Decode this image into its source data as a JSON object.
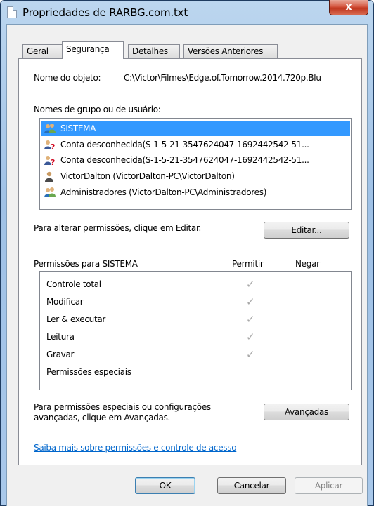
{
  "window": {
    "title": "Propriedades de RARBG.com.txt",
    "close_label": "x"
  },
  "tabs": [
    {
      "label": "Geral"
    },
    {
      "label": "Segurança"
    },
    {
      "label": "Detalhes"
    },
    {
      "label": "Versões Anteriores"
    }
  ],
  "security": {
    "object_name_label": "Nome do objeto:",
    "object_name_value": "C:\\Victor\\Filmes\\Edge.of.Tomorrow.2014.720p.Blu",
    "groups_label": "Nomes de grupo ou de usuário:",
    "groups": [
      {
        "label": "SISTEMA",
        "icon": "group-users-icon",
        "selected": true
      },
      {
        "label": "Conta desconhecida(S-1-5-21-3547624047-1692442542-51...",
        "icon": "unknown-user-icon",
        "selected": false
      },
      {
        "label": "Conta desconhecida(S-1-5-21-3547624047-1692442542-51...",
        "icon": "unknown-user-icon",
        "selected": false
      },
      {
        "label": "VictorDalton (VictorDalton-PC\\VictorDalton)",
        "icon": "user-icon",
        "selected": false
      },
      {
        "label": "Administradores (VictorDalton-PC\\Administradores)",
        "icon": "group-users-icon",
        "selected": false
      }
    ],
    "change_permissions_text": "Para alterar permissões, clique em Editar.",
    "edit_button": "Editar...",
    "permissions_for_label": "Permissões para SISTEMA",
    "allow_header": "Permitir",
    "deny_header": "Negar",
    "permissions": [
      {
        "label": "Controle total",
        "allow": true,
        "deny": false
      },
      {
        "label": "Modificar",
        "allow": true,
        "deny": false
      },
      {
        "label": "Ler & executar",
        "allow": true,
        "deny": false
      },
      {
        "label": "Leitura",
        "allow": true,
        "deny": false
      },
      {
        "label": "Gravar",
        "allow": true,
        "deny": false
      },
      {
        "label": "Permissões especiais",
        "allow": false,
        "deny": false
      }
    ],
    "check_glyph": "✓",
    "advanced_text_line1": "Para permissões especiais ou configurações",
    "advanced_text_line2": "avançadas, clique em Avançadas.",
    "advanced_button": "Avançadas",
    "learn_more_link": "Saiba mais sobre permissões e controle de acesso"
  },
  "footer": {
    "ok": "OK",
    "cancel": "Cancelar",
    "apply": "Aplicar"
  },
  "colors": {
    "selection": "#3399ff",
    "link": "#0066cc",
    "close_button": "#c0361e"
  }
}
